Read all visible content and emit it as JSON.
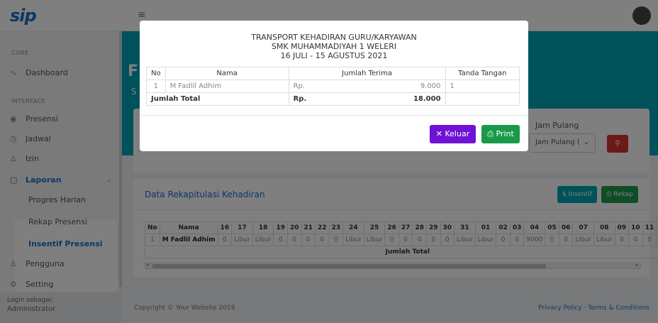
{
  "app": {
    "logo": "sip"
  },
  "sidebar": {
    "core_heading": "CORE",
    "interface_heading": "INTERFACE",
    "items": [
      {
        "label": "Dashboard",
        "icon": "pulse-icon"
      },
      {
        "label": "Presensi",
        "icon": "fingerprint-icon"
      },
      {
        "label": "Jadwal",
        "icon": "clock-icon"
      },
      {
        "label": "Izin",
        "icon": "user-icon"
      },
      {
        "label": "Laporan",
        "icon": "clipboard-icon"
      },
      {
        "label": "Pengguna",
        "icon": "users-icon"
      },
      {
        "label": "Setting",
        "icon": "gear-icon"
      }
    ],
    "laporan_sub": [
      "Progres Harian",
      "Rekap Presensi",
      "Insentif Presensi"
    ],
    "footer_label": "Login sebagai:",
    "footer_user": "Administrator"
  },
  "filter": {
    "jam_pulang_label": "Jam Pulang",
    "jam_pulang_select": "Jam Pulang ("
  },
  "rekap": {
    "title": "Data Rekapitulasi Kehadiran",
    "btn_insentif": "$ Insentif",
    "btn_rekap": "⎙ Rekap",
    "headers": [
      "No",
      "Nama",
      "16",
      "17",
      "18",
      "19",
      "20",
      "21",
      "22",
      "23",
      "24",
      "25",
      "26",
      "27",
      "28",
      "29",
      "30",
      "31",
      "01",
      "02",
      "03",
      "04",
      "05",
      "06",
      "07",
      "08",
      "09",
      "10",
      "11",
      "12"
    ],
    "row": [
      "1",
      "M Fadlil Adhim",
      "0",
      "Libur",
      "Libur",
      "0",
      "0",
      "0",
      "0",
      "0",
      "Libur",
      "Libur",
      "0",
      "0",
      "0",
      "0",
      "0",
      "Libur",
      "Libur",
      "0",
      "0",
      "9000",
      "0",
      "0",
      "Libur",
      "Libur",
      "0",
      "0",
      "0",
      "0"
    ],
    "total_label": "Jumlah Total"
  },
  "footer": {
    "copyright": "Copyright © Your Website 2019",
    "links": "Privacy Policy · Terms & Conditions"
  },
  "modal": {
    "title1": "TRANSPORT KEHADIRAN GURU/KARYAWAN",
    "title2": "SMK MUHAMMADIYAH 1 WELERI",
    "title3": "16 JULI - 15 AGUSTUS 2021",
    "headers": {
      "no": "No",
      "nama": "Nama",
      "jumlah": "Jumlah Terima",
      "ttd": "Tanda Tangan"
    },
    "row": {
      "no": "1",
      "nama": "M Fadlil Adhim",
      "rp": "Rp.",
      "amount": "9.000",
      "ttd": "1"
    },
    "total": {
      "label": "Jumlah Total",
      "rp": "Rp.",
      "amount": "18.000"
    },
    "btn_keluar": "✕ Keluar",
    "btn_print": "⎙ Print"
  }
}
